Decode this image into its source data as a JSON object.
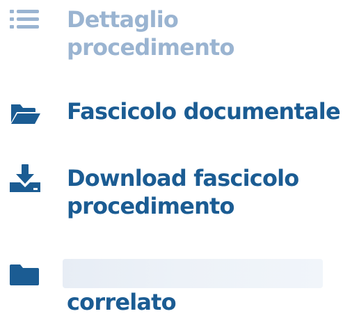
{
  "menu": {
    "items": [
      {
        "icon": "list-icon",
        "line1": "Dettaglio",
        "line2": "procedimento",
        "state": "inactive"
      },
      {
        "icon": "folder-open-icon",
        "line1": "Fascicolo documentale",
        "state": "active"
      },
      {
        "icon": "download-icon",
        "line1": "Download fascicolo",
        "line2": "procedimento",
        "state": "active"
      },
      {
        "icon": "folder-icon",
        "line2": "correlato",
        "state": "active"
      }
    ]
  },
  "colors": {
    "active_text": "#1b5c93",
    "inactive_text": "#9ab4d1",
    "redacted_bar": "#e9eff6"
  }
}
